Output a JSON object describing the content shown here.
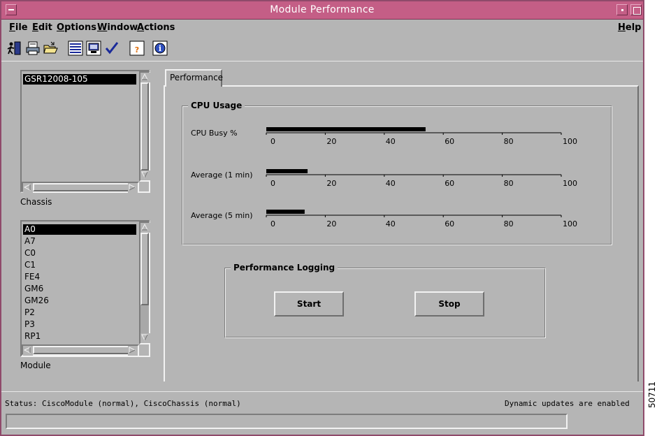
{
  "window": {
    "title": "Module Performance"
  },
  "menus": [
    {
      "label": "File",
      "mnemonic": "F",
      "rest": "ile"
    },
    {
      "label": "Edit",
      "mnemonic": "E",
      "rest": "dit"
    },
    {
      "label": "Options",
      "mnemonic": "O",
      "rest": "ptions"
    },
    {
      "label": "Window",
      "mnemonic": "W",
      "rest": "indow"
    },
    {
      "label": "Actions",
      "mnemonic": "A",
      "rest": "ctions"
    },
    {
      "label": "Help",
      "mnemonic": "H",
      "rest": "elp"
    }
  ],
  "toolbar": {
    "icons": [
      "exit-icon",
      "print-icon",
      "open-folder-icon",
      "list-view-icon",
      "monitor-icon",
      "checkmark-icon",
      "help-icon",
      "info-icon"
    ]
  },
  "chassis": {
    "items": [
      "GSR12008-105"
    ],
    "selected": "GSR12008-105",
    "label": "Chassis"
  },
  "module": {
    "items": [
      "A0",
      "A7",
      "C0",
      "C1",
      "FE4",
      "GM6",
      "GM26",
      "P2",
      "P3",
      "RP1"
    ],
    "selected": "A0",
    "label": "Module"
  },
  "tabs": [
    {
      "label": "Performance"
    }
  ],
  "cpu_usage": {
    "title": "CPU Usage",
    "ticks": [
      "0",
      "20",
      "40",
      "60",
      "80",
      "100"
    ],
    "meters": [
      {
        "label": "CPU Busy %",
        "value": 54
      },
      {
        "label": "Average (1 min)",
        "value": 14
      },
      {
        "label": "Average (5 min)",
        "value": 13
      }
    ],
    "bar_color": "#000000"
  },
  "logging": {
    "title": "Performance Logging",
    "start_label": "Start",
    "stop_label": "Stop"
  },
  "status": {
    "text": "Status: CiscoModule (normal), CiscoChassis (normal)",
    "dynamic": "Dynamic updates are enabled"
  },
  "figure_id": "50711",
  "colors": {
    "titlebar": "#c45e86",
    "window_bg": "#b5b5b5"
  }
}
